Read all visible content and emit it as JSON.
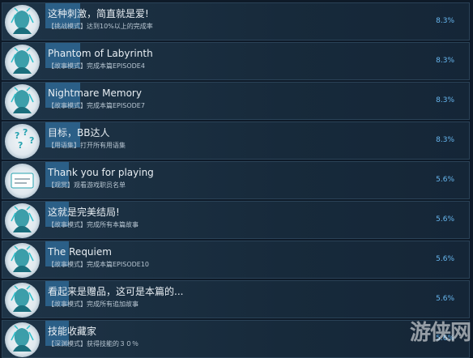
{
  "achievements": [
    {
      "title": "这种刺激，简直就是爱!",
      "category": "【挑战模式】",
      "desc": "达到10%以上的完成率",
      "percent": "8.3%",
      "percent_value": 8.3,
      "icon": "character-portrait-icon"
    },
    {
      "title": "Phantom of Labyrinth",
      "category": "【故事模式】",
      "desc": "完成本篇EPISODE4",
      "percent": "8.3%",
      "percent_value": 8.3,
      "icon": "character-portrait-icon"
    },
    {
      "title": "Nightmare Memory",
      "category": "【故事模式】",
      "desc": "完成本篇EPISODE7",
      "percent": "8.3%",
      "percent_value": 8.3,
      "icon": "character-portrait-icon"
    },
    {
      "title": "目标，BB达人",
      "category": "【用语集】",
      "desc": "打开所有用语集",
      "percent": "8.3%",
      "percent_value": 8.3,
      "icon": "question-marks-icon"
    },
    {
      "title": "Thank you for playing",
      "category": "【观赏】",
      "desc": "观看游戏职员名单",
      "percent": "5.6%",
      "percent_value": 5.6,
      "icon": "thank-you-note-icon"
    },
    {
      "title": "这就是完美结局!",
      "category": "【故事模式】",
      "desc": "完成所有本篇故事",
      "percent": "5.6%",
      "percent_value": 5.6,
      "icon": "character-portrait-icon"
    },
    {
      "title": "The Requiem",
      "category": "【故事模式】",
      "desc": "完成本篇EPISODE10",
      "percent": "5.6%",
      "percent_value": 5.6,
      "icon": "character-portrait-icon"
    },
    {
      "title": "看起来是赠品，这可是本篇的...",
      "category": "【故事模式】",
      "desc": "完成所有追加故事",
      "percent": "5.6%",
      "percent_value": 5.6,
      "icon": "character-portrait-icon"
    },
    {
      "title": "技能收藏家",
      "category": "【深渊模式】",
      "desc": "获得技能的３０％",
      "percent": "5.6%",
      "percent_value": 5.6,
      "icon": "character-portrait-icon"
    }
  ],
  "watermark": "游侠网",
  "colors": {
    "bar": "#2b5f87",
    "percent": "#67b7f0",
    "row": "#1a2e40",
    "background": "#0e1a28"
  }
}
